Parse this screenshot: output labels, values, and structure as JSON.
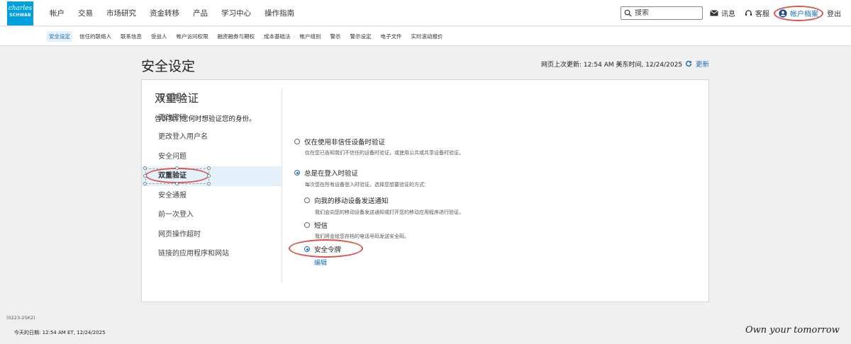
{
  "brand": {
    "logo_line1": "charles",
    "logo_line2": "SCHWAB",
    "slogan": "Own your tomorrow"
  },
  "header": {
    "nav": [
      "帐户",
      "交易",
      "市场研究",
      "资金转移",
      "产品",
      "学习中心",
      "操作指南"
    ],
    "search_placeholder": "搜索",
    "messages": "讯息",
    "service": "客服",
    "profile": "帐户档案",
    "logout": "登出"
  },
  "subnav": [
    "安全设定",
    "信任的联络人",
    "联系信息",
    "受益人",
    "帐户访问权限",
    "融资融券与期权",
    "成本基础法",
    "帐户组别",
    "警示",
    "警示设定",
    "电子文件",
    "实时滚动报价"
  ],
  "page": {
    "title": "安全设定",
    "last_updated": "网页上次更新: 12:54 AM 美东时间, 12/24/2025",
    "refresh": "更新"
  },
  "sidebar": [
    "安全建议",
    "更改密码",
    "更改登入用户名",
    "安全问题",
    "双重验证",
    "安全通报",
    "前一次登入",
    "网页操作超时",
    "链接的应用程序和网站"
  ],
  "sidebar_active_index": 4,
  "section": {
    "title": "双重验证",
    "prompt": "告诉我们您何时想验证您的身份。",
    "option_untrusted": {
      "label": "仅在使用非信任设备时验证",
      "desc": "仅在您已告知我们不信任的设备时验证，或使用公共或共享设备时验证。"
    },
    "option_always": {
      "label": "总是在登入时验证",
      "desc": "每次您在所有设备登入时验证。选择您想要验证的方式："
    },
    "method_push": {
      "label": "向我的移动设备发送通知",
      "desc": "我们会向您的移动设备发送通知或打开您的移动应用程序进行验证。"
    },
    "method_sms": {
      "label": "短信",
      "desc": "我们将会给您存档的电话号码发送安全码。"
    },
    "method_token": {
      "label": "安全令牌"
    },
    "edit": "编辑"
  },
  "footer": {
    "code": "(0223-25K2)",
    "date": "今天的日期: 12:54 AM ET, 12/24/2025"
  },
  "colors": {
    "accent": "#1a6fb8",
    "logo": "#00a0df",
    "annotation": "#d9534f"
  }
}
